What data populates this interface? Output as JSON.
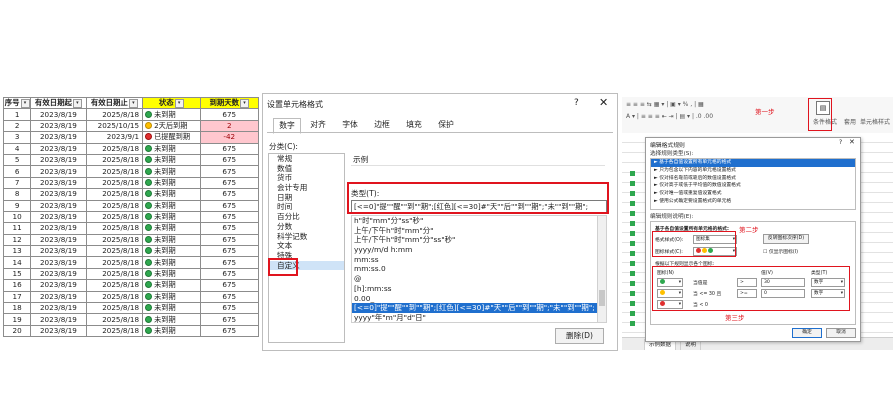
{
  "sheet": {
    "headers": [
      "序号",
      "有效日期起",
      "有效日期止",
      "状态",
      "到期天数"
    ],
    "rows": [
      {
        "no": "1",
        "start": "2023/8/19",
        "end": "2025/8/18",
        "dot": "green",
        "status": "未到期",
        "days": "675",
        "warn": false
      },
      {
        "no": "2",
        "start": "2023/8/19",
        "end": "2025/10/15",
        "dot": "yellow",
        "status": "2天后到期",
        "days": "2",
        "warn": true
      },
      {
        "no": "3",
        "start": "2023/8/19",
        "end": "2023/9/1",
        "dot": "red",
        "status": "已提醒到期",
        "days": "-42",
        "warn": true
      },
      {
        "no": "4",
        "start": "2023/8/19",
        "end": "2025/8/18",
        "dot": "green",
        "status": "未到期",
        "days": "675",
        "warn": false
      },
      {
        "no": "5",
        "start": "2023/8/19",
        "end": "2025/8/18",
        "dot": "green",
        "status": "未到期",
        "days": "675",
        "warn": false
      },
      {
        "no": "6",
        "start": "2023/8/19",
        "end": "2025/8/18",
        "dot": "green",
        "status": "未到期",
        "days": "675",
        "warn": false
      },
      {
        "no": "7",
        "start": "2023/8/19",
        "end": "2025/8/18",
        "dot": "green",
        "status": "未到期",
        "days": "675",
        "warn": false
      },
      {
        "no": "8",
        "start": "2023/8/19",
        "end": "2025/8/18",
        "dot": "green",
        "status": "未到期",
        "days": "675",
        "warn": false
      },
      {
        "no": "9",
        "start": "2023/8/19",
        "end": "2025/8/18",
        "dot": "green",
        "status": "未到期",
        "days": "675",
        "warn": false
      },
      {
        "no": "10",
        "start": "2023/8/19",
        "end": "2025/8/18",
        "dot": "green",
        "status": "未到期",
        "days": "675",
        "warn": false
      },
      {
        "no": "11",
        "start": "2023/8/19",
        "end": "2025/8/18",
        "dot": "green",
        "status": "未到期",
        "days": "675",
        "warn": false
      },
      {
        "no": "12",
        "start": "2023/8/19",
        "end": "2025/8/18",
        "dot": "green",
        "status": "未到期",
        "days": "675",
        "warn": false
      },
      {
        "no": "13",
        "start": "2023/8/19",
        "end": "2025/8/18",
        "dot": "green",
        "status": "未到期",
        "days": "675",
        "warn": false
      },
      {
        "no": "14",
        "start": "2023/8/19",
        "end": "2025/8/18",
        "dot": "green",
        "status": "未到期",
        "days": "675",
        "warn": false
      },
      {
        "no": "15",
        "start": "2023/8/19",
        "end": "2025/8/18",
        "dot": "green",
        "status": "未到期",
        "days": "675",
        "warn": false
      },
      {
        "no": "16",
        "start": "2023/8/19",
        "end": "2025/8/18",
        "dot": "green",
        "status": "未到期",
        "days": "675",
        "warn": false
      },
      {
        "no": "17",
        "start": "2023/8/19",
        "end": "2025/8/18",
        "dot": "green",
        "status": "未到期",
        "days": "675",
        "warn": false
      },
      {
        "no": "18",
        "start": "2023/8/19",
        "end": "2025/8/18",
        "dot": "green",
        "status": "未到期",
        "days": "675",
        "warn": false
      },
      {
        "no": "19",
        "start": "2023/8/19",
        "end": "2025/8/18",
        "dot": "green",
        "status": "未到期",
        "days": "675",
        "warn": false
      },
      {
        "no": "20",
        "start": "2023/8/19",
        "end": "2025/8/18",
        "dot": "green",
        "status": "未到期",
        "days": "675",
        "warn": false
      }
    ]
  },
  "format_dialog": {
    "title": "设置单元格格式",
    "help": "?",
    "close": "✕",
    "tabs": [
      "数字",
      "对齐",
      "字体",
      "边框",
      "填充",
      "保护"
    ],
    "category_label": "分类(C):",
    "categories": [
      "常规",
      "数值",
      "货币",
      "会计专用",
      "日期",
      "时间",
      "百分比",
      "分数",
      "科学记数",
      "文本",
      "特殊",
      "自定义"
    ],
    "selected_category": "自定义",
    "sample_label": "示例",
    "type_label": "类型(T):",
    "type_value": "[<=0]\"提\"\"醒\"\"到\"\"期\";[红色][<=30]#\"天\"\"后\"\"到\"\"期\";\"未\"\"到\"\"期\";",
    "formats": [
      "h\"时\"mm\"分\"ss\"秒\"",
      "上午/下午h\"时\"mm\"分\"",
      "上午/下午h\"时\"mm\"分\"ss\"秒\"",
      "yyyy/m/d h:mm",
      "mm:ss",
      "mm:ss.0",
      "@",
      "[h]:mm:ss",
      "0.00_",
      "[<=0]\"提\"\"醒\"\"到\"\"期\";[红色][<=30]#\"天\"\"后\"\"到\"\"期\";\"未\"\"到\"\"期\";",
      "yyyy\"年\"m\"月\"d\"日\""
    ],
    "selected_format_index": 9,
    "delete_button": "删除(D)"
  },
  "cf_panel": {
    "ribbon_labels": [
      "条件格式",
      "套用",
      "单元格样式"
    ],
    "sheet_tabs": [
      "示例数据",
      "说明"
    ],
    "step1": "第一步",
    "step2": "第二步",
    "step3": "第三步",
    "dialog": {
      "title": "编辑格式规则",
      "select_rule_label": "选择规则类型(S):",
      "rule_types": [
        "► 基于各自值设置所有单元格的格式",
        "► 只为包含以下内容的单元格设置格式",
        "► 仅对排名靠前或靠后的数值设置格式",
        "► 仅对高于或低于平均值的数值设置格式",
        "► 仅对唯一值或重复值设置格式",
        "► 使用公式确定要设置格式的单元格"
      ],
      "edit_rule_label": "编辑规则说明(E):",
      "edit_rule_subtitle": "基于各自值设置所有单元格的格式:",
      "format_style_label": "格式样式(O):",
      "format_style_value": "图标集",
      "reverse_button": "反转图标次序(D)",
      "icon_style_label": "图标样式(C):",
      "show_icon_only": "仅显示图标(I)",
      "rule_hint": "根据以下规则显示各个图标:",
      "col_icon": "图标(N)",
      "col_value": "值(V)",
      "col_type": "类型(T)",
      "icon_rows": [
        {
          "color": "#2fa84f",
          "cond": "当值是",
          "op": ">",
          "val": "30",
          "type": "数字"
        },
        {
          "color": "#ffc000",
          "cond": "当 <= 30 且",
          "op": ">=",
          "val": "0",
          "type": "数字"
        },
        {
          "color": "#e03030",
          "cond": "当 < 0",
          "op": "",
          "val": "",
          "type": ""
        }
      ],
      "ok": "确定",
      "cancel": "取消"
    }
  },
  "colors": {
    "highlight_yellow": "#ffff00",
    "warn_fill": "#ffc7ce",
    "warn_text": "#9c0006",
    "annotation_red": "#e0141e",
    "selection_blue": "#1f6fce"
  }
}
